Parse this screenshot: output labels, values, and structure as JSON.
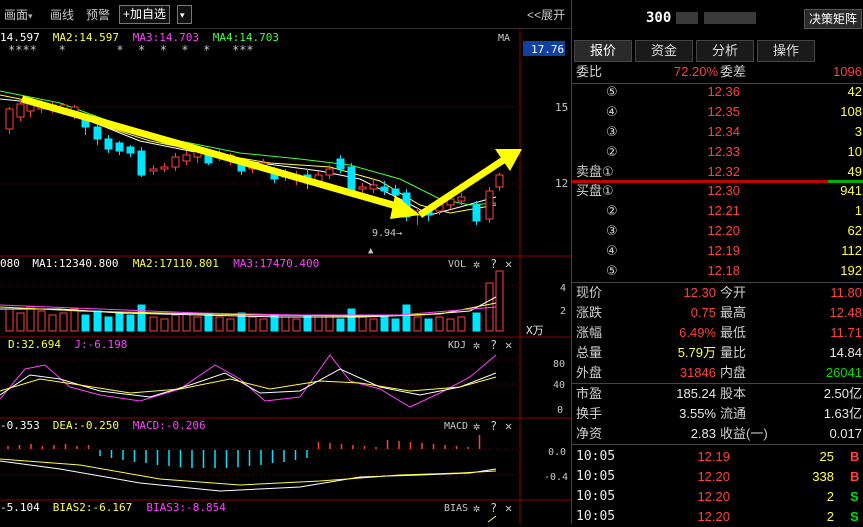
{
  "toolbar": {
    "draw_label": "画面",
    "draw_arrow": "▾",
    "line_label": "画线",
    "alert_label": "预警",
    "add_fav_label": "+加自选",
    "add_fav_arrow": "▾",
    "expand_label": "<<展开"
  },
  "main_chart": {
    "ma_labels": [
      {
        "text": "14.597",
        "color": "#ffffff"
      },
      {
        "text": "MA2:14.597",
        "color": "#ffff40"
      },
      {
        "text": "MA3:14.703",
        "color": "#ff40ff"
      },
      {
        "text": "MA4:14.703",
        "color": "#40ff40"
      }
    ],
    "ma_tag": "MA",
    "stars": "****   *       *  *  *  *  *   ***",
    "price_tag": "17.76",
    "axis_labels": [
      "15",
      "12"
    ],
    "low_label": "9.94→",
    "colors": {
      "up": "#ff4040",
      "down": "#00e5ff",
      "arrow": "#ffff00",
      "ma1": "#ffffff",
      "ma2": "#ffff40",
      "ma3": "#40ff40"
    }
  },
  "vol_panel": {
    "labels": [
      {
        "text": "080",
        "color": "#ffffff"
      },
      {
        "text": "MA1:12340.800",
        "color": "#ffffff"
      },
      {
        "text": "MA2:17110.801",
        "color": "#ffff40"
      },
      {
        "text": "MA3:17470.400",
        "color": "#ff40ff"
      }
    ],
    "name": "VOL",
    "axis_labels": [
      "4",
      "2"
    ],
    "unit": "X万"
  },
  "kdj_panel": {
    "labels": [
      {
        "text": "D:32.694",
        "color": "#ffff40"
      },
      {
        "text": "J:-6.198",
        "color": "#ff40ff"
      }
    ],
    "name": "KDJ",
    "axis_labels": [
      "80",
      "40",
      "0"
    ]
  },
  "macd_panel": {
    "labels": [
      {
        "text": "-0.353",
        "color": "#ffffff"
      },
      {
        "text": "DEA:-0.250",
        "color": "#ffff40"
      },
      {
        "text": "MACD:-0.206",
        "color": "#ff40ff"
      }
    ],
    "name": "MACD",
    "axis_labels": [
      "0.0",
      "-0.4"
    ]
  },
  "bias_panel": {
    "labels": [
      {
        "text": "-5.104",
        "color": "#ffffff"
      },
      {
        "text": "BIAS2:-6.167",
        "color": "#ffff40"
      },
      {
        "text": "BIAS3:-8.854",
        "color": "#ff40ff"
      }
    ],
    "name": "BIAS"
  },
  "panel_icons": {
    "gear": "✲",
    "help": "?",
    "close": "✕"
  },
  "stock": {
    "code": "300",
    "decision_button": "决策矩阵"
  },
  "tabs": [
    "报价",
    "资金",
    "分析",
    "操作"
  ],
  "order_ratio": {
    "label1": "委比",
    "value1": "72.20%",
    "label2": "委差",
    "value2": "1096"
  },
  "asks": [
    {
      "level": "⑤",
      "price": "12.36",
      "vol": "42"
    },
    {
      "level": "④",
      "price": "12.35",
      "vol": "108"
    },
    {
      "level": "③",
      "price": "12.34",
      "vol": "3"
    },
    {
      "level": "②",
      "price": "12.33",
      "vol": "10"
    },
    {
      "level": "卖盘①",
      "price": "12.32",
      "vol": "49"
    }
  ],
  "bids": [
    {
      "level": "买盘①",
      "price": "12.30",
      "vol": "941"
    },
    {
      "level": "②",
      "price": "12.21",
      "vol": "1"
    },
    {
      "level": "③",
      "price": "12.20",
      "vol": "62"
    },
    {
      "level": "④",
      "price": "12.19",
      "vol": "112"
    },
    {
      "level": "⑤",
      "price": "12.18",
      "vol": "192"
    }
  ],
  "quote": [
    {
      "l1": "现价",
      "v1": "12.30",
      "c1": "red",
      "l2": "今开",
      "v2": "11.80",
      "c2": "red"
    },
    {
      "l1": "涨跌",
      "v1": "0.75",
      "c1": "red",
      "l2": "最高",
      "v2": "12.48",
      "c2": "red"
    },
    {
      "l1": "涨幅",
      "v1": "6.49%",
      "c1": "red",
      "l2": "最低",
      "v2": "11.71",
      "c2": "red"
    },
    {
      "l1": "总量",
      "v1": "5.79万",
      "c1": "yel",
      "l2": "量比",
      "v2": "14.84",
      "c2": "wht"
    },
    {
      "l1": "外盘",
      "v1": "31846",
      "c1": "red",
      "l2": "内盘",
      "v2": "26041",
      "c2": "grn"
    }
  ],
  "fundamentals": [
    {
      "l1": "市盈",
      "v1": "185.24",
      "l2": "股本",
      "v2": "2.50亿"
    },
    {
      "l1": "换手",
      "v1": "3.55%",
      "l2": "流通",
      "v2": "1.63亿"
    },
    {
      "l1": "净资",
      "v1": "2.83",
      "l2": "收益(一)",
      "v2": "0.017"
    }
  ],
  "ticks": [
    {
      "time": "10:05",
      "price": "12.19",
      "vol": "25",
      "side": "B",
      "color": "red"
    },
    {
      "time": "10:05",
      "price": "12.20",
      "vol": "338",
      "side": "B",
      "color": "red"
    },
    {
      "time": "10:05",
      "price": "12.20",
      "vol": "2",
      "side": "S",
      "color": "grn"
    },
    {
      "time": "10:05",
      "price": "12.20",
      "vol": "2",
      "side": "S",
      "color": "grn"
    }
  ]
}
